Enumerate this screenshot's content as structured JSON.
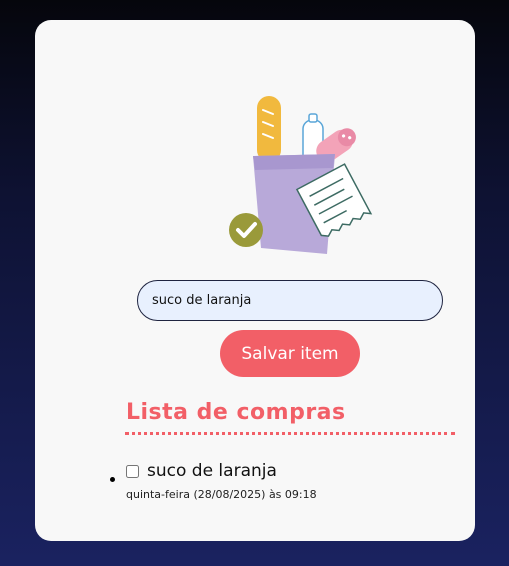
{
  "form": {
    "item_value": "suco de laranja",
    "save_label": "Salvar item"
  },
  "list": {
    "title": "Lista de compras",
    "items": [
      {
        "name": "suco de laranja",
        "checked": false,
        "date": "quinta-feira (28/08/2025) às 09:18"
      }
    ]
  },
  "colors": {
    "accent": "#f25f67",
    "input_bg": "#e8f0fe",
    "card_bg": "#f8f8f8",
    "check_badge": "#9a9a3a"
  },
  "icons": [
    "grocery-bag-illustration",
    "check-badge-icon"
  ]
}
